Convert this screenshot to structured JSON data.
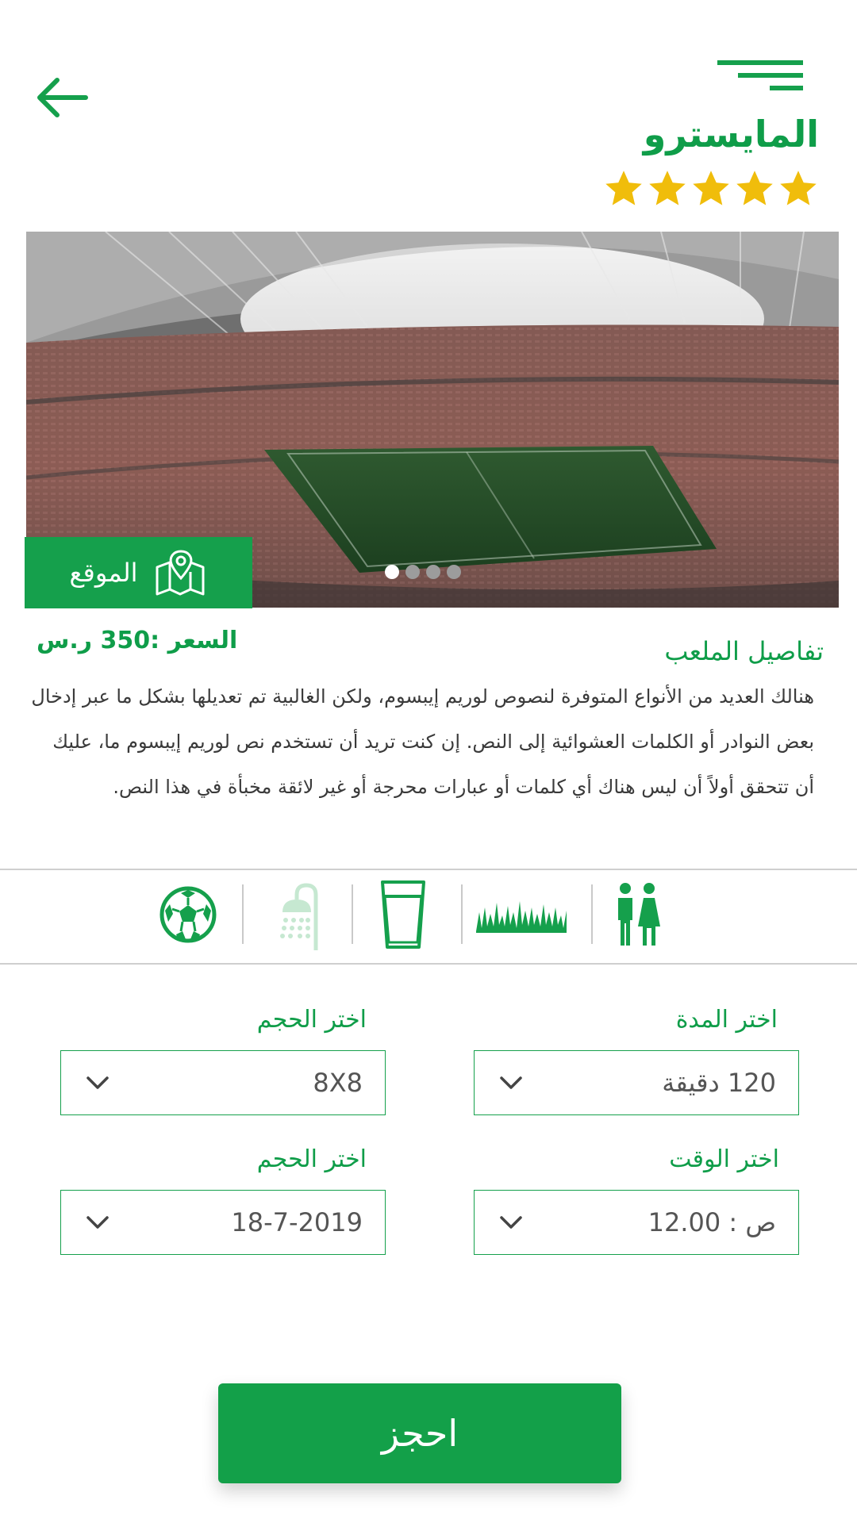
{
  "header": {
    "back_icon": "arrow-left-icon",
    "menu_icon": "hamburger-menu-icon",
    "title": "المايسترو",
    "rating": 5,
    "rating_max": 5,
    "star_color": "#f0bd0b"
  },
  "hero": {
    "image": "stadium-photo",
    "slides_total": 4,
    "active_slide": 1,
    "location_label": "الموقع",
    "location_icon": "map-pin-icon"
  },
  "details": {
    "price": "السعر :350 ر.س",
    "title": "تفاصيل الملعب",
    "description": "هنالك العديد من الأنواع المتوفرة لنصوص لوريم إيبسوم، ولكن الغالبية تم تعديلها بشكل ما عبر إدخال بعض النوادر أو الكلمات العشوائية إلى النص. إن كنت تريد أن تستخدم نص لوريم إيبسوم ما، عليك أن تتحقق أولاً أن ليس هناك أي كلمات أو عبارات محرجة أو غير لائقة مخبأة في هذا النص."
  },
  "amenities": [
    {
      "icon": "restroom-icon",
      "available": true
    },
    {
      "icon": "grass-icon",
      "available": true
    },
    {
      "icon": "water-glass-icon",
      "available": true
    },
    {
      "icon": "shower-icon",
      "available": false
    },
    {
      "icon": "football-icon",
      "available": true
    }
  ],
  "form": {
    "duration": {
      "label": "اختر المدة",
      "value": "120 دقيقة"
    },
    "size": {
      "label": "اختر الحجم",
      "value": "8X8"
    },
    "time": {
      "label": "اختر الوقت",
      "value": "ص : 12.00"
    },
    "date": {
      "label": "اختر الحجم",
      "value": "18-7-2019"
    }
  },
  "book_button": {
    "label": "احجز"
  },
  "colors": {
    "primary": "#13a049",
    "star": "#f0bd0b",
    "inactive": "#c6e8d1"
  }
}
